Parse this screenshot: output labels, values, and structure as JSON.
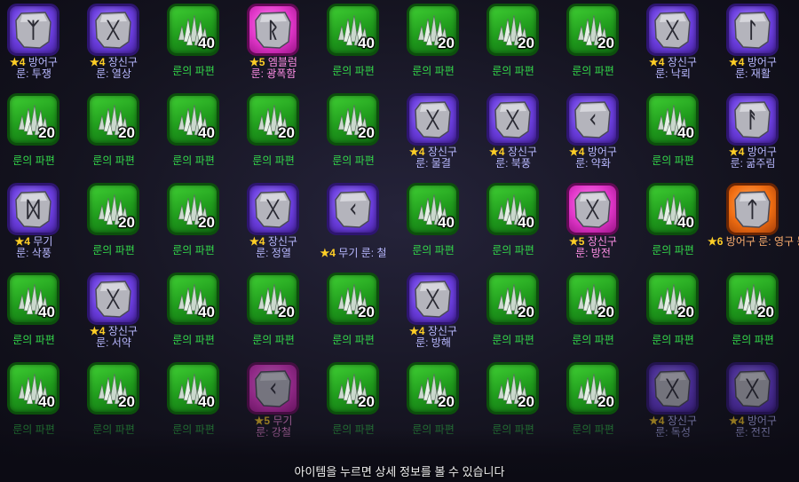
{
  "hint": "아이템을 누르면 상세 정보를 볼 수 있습니다",
  "colors": {
    "common": "#2fb82a",
    "rare": "#7b4ef0",
    "legend": "#e43fcf",
    "epic": "#f07318",
    "star": "#ffcf26"
  },
  "shard_name": "룬의 파편",
  "items": [
    {
      "kind": "rune",
      "rarity": "purple",
      "glyph": "ᛉ",
      "grade": "4",
      "type": "방어구",
      "name": "룬: 투쟁"
    },
    {
      "kind": "rune",
      "rarity": "purple",
      "glyph": "ᚷ",
      "grade": "4",
      "type": "장신구",
      "name": "룬: 열상"
    },
    {
      "kind": "shard",
      "count": "40"
    },
    {
      "kind": "rune",
      "rarity": "pink",
      "glyph": "ᚱ",
      "grade": "5",
      "type": "엠블럼",
      "name": "룬: 광폭함"
    },
    {
      "kind": "shard",
      "count": "40"
    },
    {
      "kind": "shard",
      "count": "20"
    },
    {
      "kind": "shard",
      "count": "20"
    },
    {
      "kind": "shard",
      "count": "20"
    },
    {
      "kind": "rune",
      "rarity": "purple",
      "glyph": "ᚷ",
      "grade": "4",
      "type": "장신구",
      "name": "룬: 낙뢰"
    },
    {
      "kind": "rune",
      "rarity": "purple",
      "glyph": "ᛚ",
      "grade": "4",
      "type": "방어구",
      "name": "룬: 재활"
    },
    {
      "kind": "shard",
      "count": "20"
    },
    {
      "kind": "shard",
      "count": "20"
    },
    {
      "kind": "shard",
      "count": "40"
    },
    {
      "kind": "shard",
      "count": "20"
    },
    {
      "kind": "shard",
      "count": "20"
    },
    {
      "kind": "rune",
      "rarity": "purple",
      "glyph": "ᚷ",
      "grade": "4",
      "type": "장신구",
      "name": "룬: 물결"
    },
    {
      "kind": "rune",
      "rarity": "purple",
      "glyph": "ᚷ",
      "grade": "4",
      "type": "장신구",
      "name": "룬: 북풍"
    },
    {
      "kind": "rune",
      "rarity": "purple",
      "glyph": "ᚲ",
      "grade": "4",
      "type": "방어구",
      "name": "룬: 약화"
    },
    {
      "kind": "shard",
      "count": "40"
    },
    {
      "kind": "rune",
      "rarity": "purple",
      "glyph": "ᚨ",
      "grade": "4",
      "type": "방어구",
      "name": "룬: 굶주림"
    },
    {
      "kind": "rune",
      "rarity": "purple",
      "glyph": "ᛞ",
      "grade": "4",
      "type": "무기",
      "name": "룬: 삭풍"
    },
    {
      "kind": "shard",
      "count": "20"
    },
    {
      "kind": "shard",
      "count": "20"
    },
    {
      "kind": "rune",
      "rarity": "purple",
      "glyph": "ᚷ",
      "grade": "4",
      "type": "장신구",
      "name": "룬: 정열"
    },
    {
      "kind": "rune",
      "rarity": "purple",
      "glyph": "ᚲ",
      "grade": "4",
      "type": "무기",
      "name": "룬: 철",
      "oneline": true
    },
    {
      "kind": "shard",
      "count": "40"
    },
    {
      "kind": "shard",
      "count": "40"
    },
    {
      "kind": "rune",
      "rarity": "pink",
      "glyph": "ᚷ",
      "grade": "5",
      "type": "장신구",
      "name": "룬: 방전"
    },
    {
      "kind": "shard",
      "count": "40"
    },
    {
      "kind": "rune",
      "rarity": "orange",
      "glyph": "ᛏ",
      "grade": "6",
      "type": "방어구",
      "name": "룬: 영구 동토"
    },
    {
      "kind": "shard",
      "count": "40"
    },
    {
      "kind": "rune",
      "rarity": "purple",
      "glyph": "ᚷ",
      "grade": "4",
      "type": "장신구",
      "name": "룬: 서약"
    },
    {
      "kind": "shard",
      "count": "40"
    },
    {
      "kind": "shard",
      "count": "20"
    },
    {
      "kind": "shard",
      "count": "20"
    },
    {
      "kind": "rune",
      "rarity": "purple",
      "glyph": "ᚷ",
      "grade": "4",
      "type": "장신구",
      "name": "룬: 방해"
    },
    {
      "kind": "shard",
      "count": "20"
    },
    {
      "kind": "shard",
      "count": "20"
    },
    {
      "kind": "shard",
      "count": "20"
    },
    {
      "kind": "shard",
      "count": "20"
    },
    {
      "kind": "shard",
      "count": "40"
    },
    {
      "kind": "shard",
      "count": "20"
    },
    {
      "kind": "shard",
      "count": "40"
    },
    {
      "kind": "rune",
      "rarity": "pink",
      "glyph": "ᚲ",
      "grade": "5",
      "type": "무기",
      "name": "룬: 강철",
      "faded": true
    },
    {
      "kind": "shard",
      "count": "20"
    },
    {
      "kind": "shard",
      "count": "20"
    },
    {
      "kind": "shard",
      "count": "20"
    },
    {
      "kind": "shard",
      "count": "20"
    },
    {
      "kind": "rune",
      "rarity": "purple",
      "glyph": "ᚷ",
      "grade": "4",
      "type": "장신구",
      "name": "룬: 독성",
      "faded": true
    },
    {
      "kind": "rune",
      "rarity": "purple",
      "glyph": "ᚷ",
      "grade": "4",
      "type": "방어구",
      "name": "룬: 전진",
      "faded": true
    }
  ]
}
